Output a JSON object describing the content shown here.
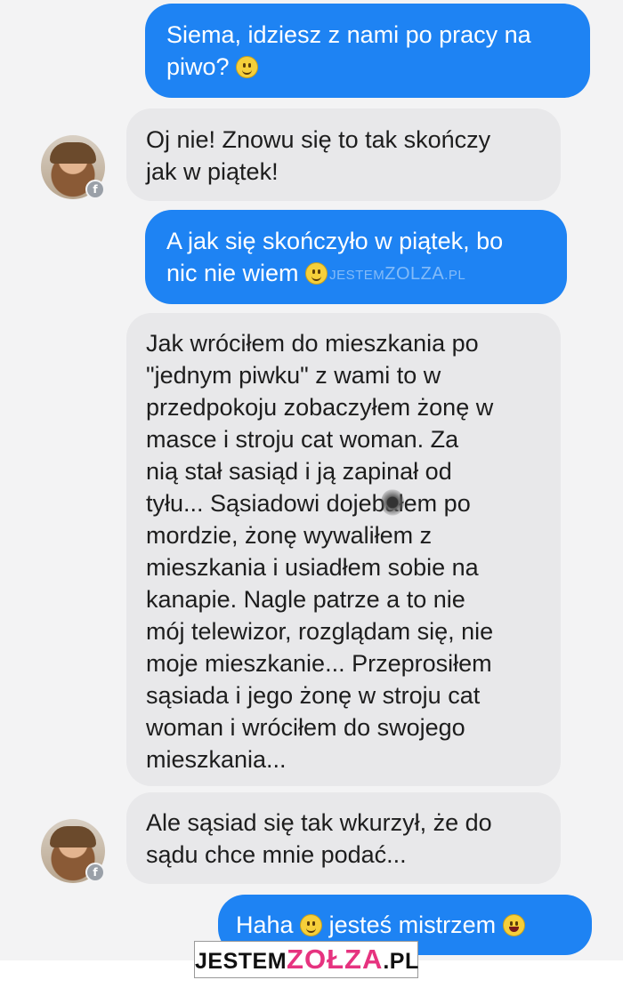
{
  "conversation": {
    "messages": [
      {
        "side": "outgoing",
        "lines": [
          "Siema, idziesz z nami po pracy na",
          "piwo?"
        ],
        "emoji": "slightly-smiling-emoji"
      },
      {
        "side": "incoming",
        "lines": [
          "Oj nie! Znowu się to tak skończy",
          "jak w piątek!"
        ]
      },
      {
        "side": "outgoing",
        "lines": [
          "A jak się skończyło w piątek, bo",
          "nic nie wiem"
        ],
        "emoji": "grinning-emoji"
      },
      {
        "side": "incoming",
        "lines": [
          "Jak wróciłem do mieszkania po",
          "\"jednym piwku\" z wami to w",
          "przedpokoju zobaczyłem żonę w",
          "masce i stroju cat woman. Za",
          "nią stał sasiąd i ją zapinał od",
          "tyłu... Sąsiadowi dojebałem po",
          "mordzie, żonę wywaliłem z",
          "mieszkania i usiadłem sobie na",
          "kanapie. Nagle patrze a to nie",
          "mój telewizor, rozglądam się, nie",
          "moje mieszkanie... Przeprosiłem",
          "sąsiada i jego żonę w stroju cat",
          "woman i wróciłem do swojego",
          "mieszkania..."
        ]
      },
      {
        "side": "incoming",
        "lines": [
          "Ale sąsiad się tak wkurzył, że do",
          "sądu chce mnie podać..."
        ]
      },
      {
        "side": "outgoing",
        "parts": [
          "Haha",
          "jesteś mistrzem"
        ],
        "emojis": [
          "grinning-emoji",
          "tongue-out-emoji"
        ]
      }
    ],
    "avatar_badge": "f",
    "colors": {
      "outgoing": "#1e83f3",
      "incoming": "#e8e8ea",
      "background": "#f3f3f4"
    }
  },
  "watermarks": {
    "inline": {
      "prefix": "JESTEM",
      "accent": "ZOLZA",
      "suffix": ".PL"
    },
    "footer": {
      "prefix": "JESTEM",
      "accent": "ZOŁZA",
      "suffix": ".PL",
      "accent_color": "#e6337f"
    }
  }
}
